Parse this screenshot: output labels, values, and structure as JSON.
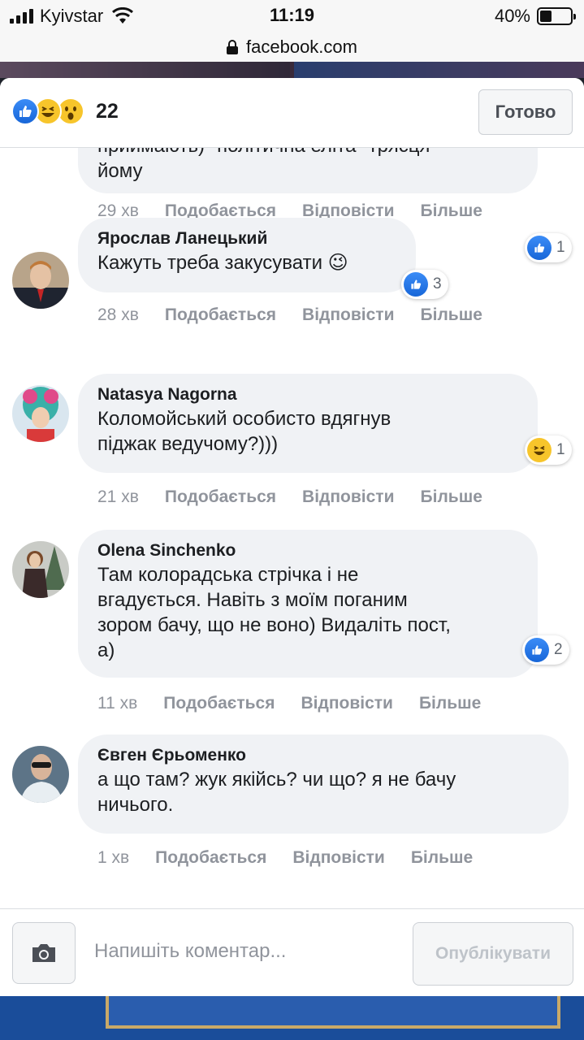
{
  "status_bar": {
    "carrier": "Kyivstar",
    "time": "11:19",
    "battery_pct": "40%",
    "battery_level": 0.4
  },
  "url_bar": {
    "domain": "facebook.com"
  },
  "header": {
    "reaction_count": "22",
    "reactions": [
      "like-icon",
      "haha-icon",
      "wow-icon"
    ],
    "done_label": "Готово"
  },
  "comments": [
    {
      "name": "",
      "text_lines": [
        "приймають) \"політична еліта\" трясця",
        "йому"
      ],
      "reaction": "like",
      "reaction_count": "1",
      "time": "29 хв"
    },
    {
      "name": "Ярослав Ланецький",
      "text_lines": [
        "Кажуть треба закусувати 😉"
      ],
      "reaction": "like",
      "reaction_count": "3",
      "time": "28 хв"
    },
    {
      "name": "Natasya Nagorna",
      "text_lines": [
        "Коломойський особисто вдягнув",
        "піджак ведучому?)))"
      ],
      "reaction": "haha",
      "reaction_count": "1",
      "time": "21 хв"
    },
    {
      "name": "Olena Sinchenko",
      "text_lines": [
        "Там колорадська стрічка і не",
        "вгадується. Навіть з моїм поганим",
        "зором бачу, що не воно) Видаліть пост,",
        "а)"
      ],
      "reaction": "like",
      "reaction_count": "2",
      "time": "11 хв"
    },
    {
      "name": "Євген Єрьоменко",
      "text_lines": [
        "а що там? жук якійсь? чи що? я не бачу",
        "ничього."
      ],
      "reaction": "",
      "reaction_count": "",
      "time": "1 хв"
    }
  ],
  "actions": {
    "like": "Подобається",
    "reply": "Відповісти",
    "more": "Більше"
  },
  "composer": {
    "placeholder": "Напишіть коментар...",
    "publish_label": "Опублікувати"
  },
  "colors": {
    "like_blue": "#1766d8",
    "bubble_bg": "#f0f2f5",
    "meta_gray": "#90949c"
  }
}
